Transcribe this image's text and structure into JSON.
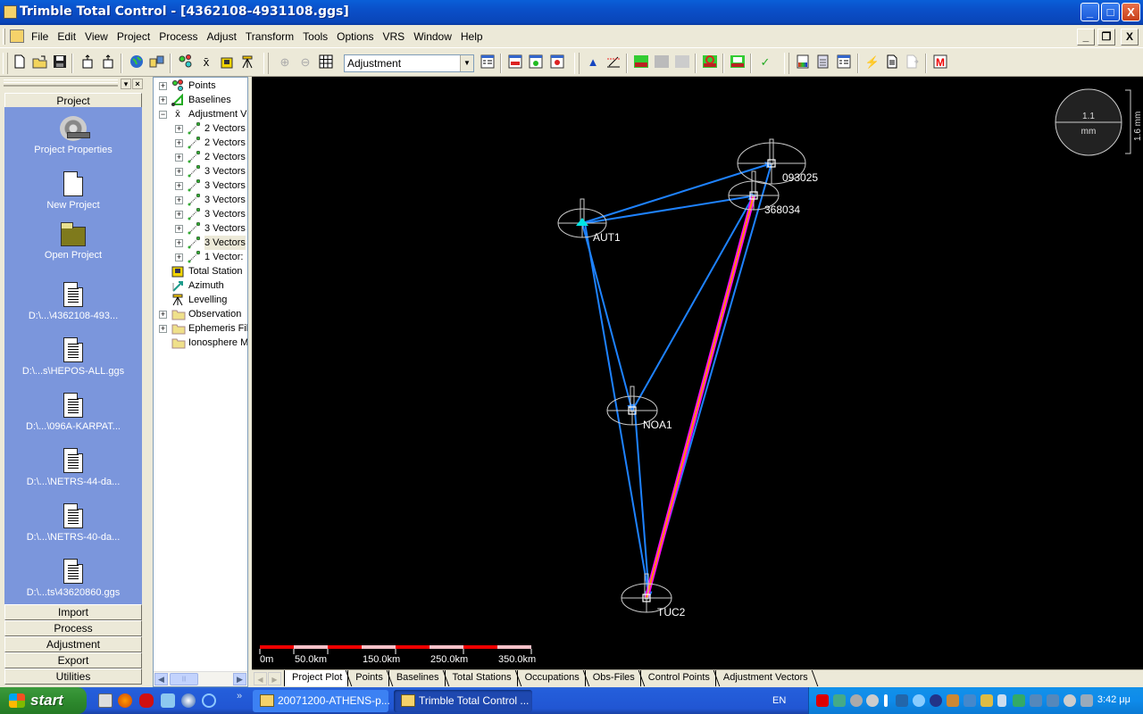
{
  "window": {
    "title": "Trimble Total Control - [4362108-4931108.ggs]",
    "controls": {
      "minimize": "_",
      "maximize": "□",
      "close": "X"
    }
  },
  "menubar": {
    "items": [
      "File",
      "Edit",
      "View",
      "Project",
      "Process",
      "Adjust",
      "Transform",
      "Tools",
      "Options",
      "VRS",
      "Window",
      "Help"
    ],
    "mdi_controls": {
      "minimize": "_",
      "restore": "❐",
      "close": "X"
    }
  },
  "toolbar": {
    "view_combo": {
      "value": "Adjustment"
    },
    "icons": [
      "new-icon",
      "open-icon",
      "save-icon",
      "import-icon",
      "export-icon",
      "globe-icon",
      "folder-tree-icon",
      "points-icon",
      "adjust-icon",
      "total-station-icon",
      "levelling-icon",
      "zoom-in-icon",
      "zoom-out-icon",
      "grid-icon",
      "view-list-icon",
      "window-red-icon",
      "window-green-icon",
      "window-target-icon",
      "triangle-icon",
      "azimuth-icon",
      "network-green-icon",
      "network-gray-icon",
      "network-gray2-icon",
      "network-fix-icon",
      "network-list-icon",
      "check-icon",
      "report-color-icon",
      "report-calc-icon",
      "report-list-icon",
      "lightning-icon",
      "document-icon",
      "document-export-icon",
      "m-icon"
    ]
  },
  "left_panel": {
    "header": "Project",
    "shortcuts": [
      {
        "label": "Project Properties",
        "icon": "gear-wrench-icon"
      },
      {
        "label": "New Project",
        "icon": "new-document-icon"
      },
      {
        "label": "Open Project",
        "icon": "open-folder-icon"
      },
      {
        "label": "D:\\...\\4362108-493...",
        "icon": "document-icon"
      },
      {
        "label": "D:\\...s\\HEPOS-ALL.ggs",
        "icon": "document-icon"
      },
      {
        "label": "D:\\...\\096A-KARPAT...",
        "icon": "document-icon"
      },
      {
        "label": "D:\\...\\NETRS-44-da...",
        "icon": "document-icon"
      },
      {
        "label": "D:\\...\\NETRS-40-da...",
        "icon": "document-icon"
      },
      {
        "label": "D:\\...ts\\43620860.ggs",
        "icon": "document-icon"
      }
    ],
    "groups": [
      "Import",
      "Process",
      "Adjustment",
      "Export",
      "Utilities"
    ]
  },
  "tree": {
    "nodes": [
      {
        "label": "Points",
        "level": 0,
        "expander": "+",
        "icon": "points-icon"
      },
      {
        "label": "Baselines",
        "level": 0,
        "expander": "+",
        "icon": "baselines-icon"
      },
      {
        "label": "Adjustment V",
        "level": 0,
        "expander": "−",
        "icon": "adjustment-icon"
      },
      {
        "label": "2 Vectors",
        "level": 1,
        "expander": "+",
        "icon": "vector-icon"
      },
      {
        "label": "2 Vectors",
        "level": 1,
        "expander": "+",
        "icon": "vector-icon"
      },
      {
        "label": "2 Vectors",
        "level": 1,
        "expander": "+",
        "icon": "vector-icon"
      },
      {
        "label": "3 Vectors",
        "level": 1,
        "expander": "+",
        "icon": "vector-icon"
      },
      {
        "label": "3 Vectors",
        "level": 1,
        "expander": "+",
        "icon": "vector-icon"
      },
      {
        "label": "3 Vectors",
        "level": 1,
        "expander": "+",
        "icon": "vector-icon"
      },
      {
        "label": "3 Vectors",
        "level": 1,
        "expander": "+",
        "icon": "vector-icon"
      },
      {
        "label": "3 Vectors",
        "level": 1,
        "expander": "+",
        "icon": "vector-icon"
      },
      {
        "label": "3 Vectors",
        "level": 1,
        "expander": "+",
        "icon": "vector-icon",
        "selected": true
      },
      {
        "label": "1 Vector:",
        "level": 1,
        "expander": "+",
        "icon": "vector-icon"
      },
      {
        "label": "Total Station",
        "level": 0,
        "expander": "",
        "icon": "total-station-icon"
      },
      {
        "label": "Azimuth",
        "level": 0,
        "expander": "",
        "icon": "azimuth-icon"
      },
      {
        "label": "Levelling",
        "level": 0,
        "expander": "",
        "icon": "levelling-icon"
      },
      {
        "label": "Observation",
        "level": 0,
        "expander": "+",
        "icon": "folder-icon"
      },
      {
        "label": "Ephemeris Fil",
        "level": 0,
        "expander": "+",
        "icon": "folder-icon"
      },
      {
        "label": "Ionosphere M",
        "level": 0,
        "expander": "",
        "icon": "folder-icon"
      }
    ]
  },
  "plot": {
    "stations": [
      {
        "name": "AUT1",
        "type": "control"
      },
      {
        "name": "093025",
        "type": "point"
      },
      {
        "name": "368034",
        "type": "point"
      },
      {
        "name": "NOA1",
        "type": "point"
      },
      {
        "name": "TUC2",
        "type": "point"
      }
    ],
    "vectors": [
      {
        "from": "AUT1",
        "to": "093025"
      },
      {
        "from": "AUT1",
        "to": "368034"
      },
      {
        "from": "AUT1",
        "to": "NOA1"
      },
      {
        "from": "AUT1",
        "to": "TUC2"
      },
      {
        "from": "NOA1",
        "to": "368034"
      },
      {
        "from": "NOA1",
        "to": "TUC2"
      },
      {
        "from": "093025",
        "to": "TUC2"
      },
      {
        "from": "368034",
        "to": "TUC2",
        "highlighted": true
      }
    ],
    "error_scale": {
      "value": "1.1",
      "unit": "mm",
      "vertical": "1.6 mm"
    },
    "scale_bar": {
      "labels": [
        "0m",
        "50.0km",
        "150.0km",
        "250.0km",
        "350.0km"
      ]
    }
  },
  "tabs": {
    "items": [
      "Project Plot",
      "Points",
      "Baselines",
      "Total Stations",
      "Occupations",
      "Obs-Files",
      "Control Points",
      "Adjustment Vectors"
    ],
    "active": 0
  },
  "taskbar": {
    "start_label": "start",
    "tasks": [
      {
        "label": "20071200-ATHENS-p...",
        "icon": "folder-icon"
      },
      {
        "label": "Trimble Total Control ...",
        "icon": "trimble-icon",
        "active": true
      }
    ],
    "language": "EN",
    "clock": "3:42 μμ",
    "colors": {
      "taskbar": "#245edb",
      "tray": "#0e8bea",
      "start": "#2e8a2e"
    }
  },
  "colors": {
    "vector": "#1e82ff",
    "highlight_outer": "#ff00ff",
    "highlight_inner": "#ff8c00",
    "control_point": "#00e5e5",
    "shortcut_bg": "#7b96dc"
  }
}
